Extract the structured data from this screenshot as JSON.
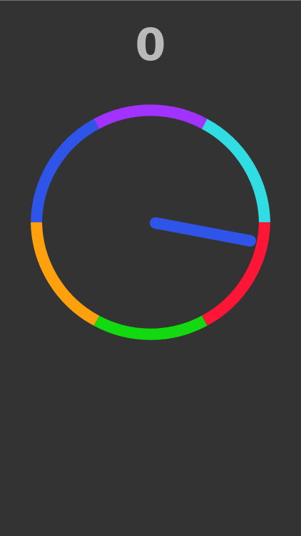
{
  "game": {
    "score": "0",
    "background_color": "#333333",
    "score_color": "#b9b9b9",
    "ring": {
      "segments": [
        {
          "name": "cyan-segment",
          "color": "#2fdde3"
        },
        {
          "name": "red-segment",
          "color": "#ff1535"
        },
        {
          "name": "green-segment",
          "color": "#12d910"
        },
        {
          "name": "orange-segment",
          "color": "#ffa10d"
        },
        {
          "name": "blue-segment",
          "color": "#2f55e8"
        },
        {
          "name": "purple-segment",
          "color": "#a232ff"
        }
      ]
    },
    "pointer": {
      "color": "#2f55e8"
    }
  }
}
